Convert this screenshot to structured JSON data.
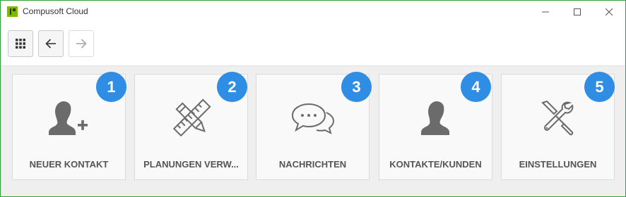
{
  "window": {
    "title": "Compusoft Cloud",
    "controls": {
      "minimize": "minimize-icon",
      "maximize": "maximize-icon",
      "close": "close-icon"
    }
  },
  "toolbar": {
    "buttons": [
      {
        "icon": "apps-grid-icon",
        "enabled": true
      },
      {
        "icon": "arrow-left-icon",
        "enabled": true
      },
      {
        "icon": "arrow-right-icon",
        "enabled": false
      }
    ]
  },
  "tiles": [
    {
      "label": "NEUER KONTAKT",
      "badge": "1",
      "icon": "add-person-icon"
    },
    {
      "label": "PLANUNGEN VERW...",
      "badge": "2",
      "icon": "pencil-ruler-icon"
    },
    {
      "label": "NACHRICHTEN",
      "badge": "3",
      "icon": "chat-bubbles-icon"
    },
    {
      "label": "KONTAKTE/KUNDEN",
      "badge": "4",
      "icon": "person-icon"
    },
    {
      "label": "EINSTELLUNGEN",
      "badge": "5",
      "icon": "tools-icon"
    }
  ],
  "colors": {
    "window_border": "#2e9e3f",
    "badge": "#2f8de4",
    "tile_icon": "#6b6b6b",
    "tile_label": "#555555"
  }
}
